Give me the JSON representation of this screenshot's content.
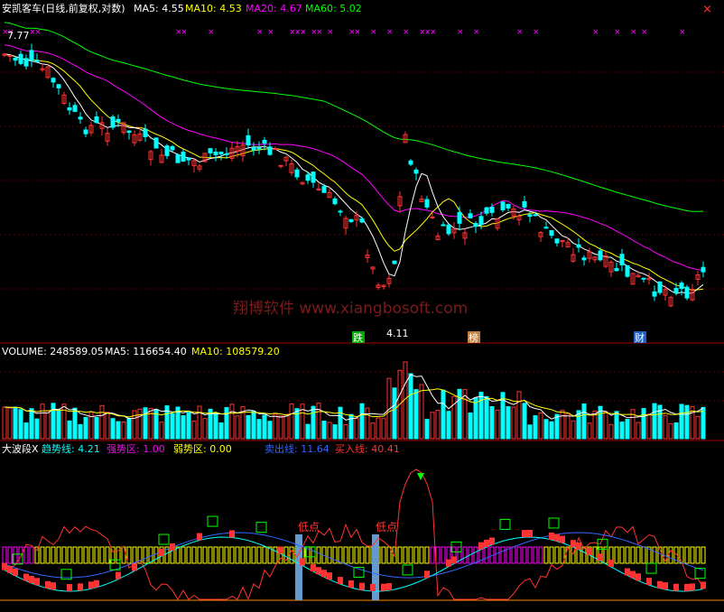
{
  "main_panel": {
    "title": "安凯客车(日线,前复权,对数)",
    "ma_labels": [
      {
        "name": "MA5",
        "value": "4.55",
        "color": "#ffffff"
      },
      {
        "name": "MA10",
        "value": "4.53",
        "color": "#ffff00"
      },
      {
        "name": "MA20",
        "value": "4.67",
        "color": "#ff00ff"
      },
      {
        "name": "MA60",
        "value": "5.02",
        "color": "#00ff00"
      }
    ],
    "high_label": "7.77",
    "low_label": "4.11",
    "markers": [
      "跌",
      "榜",
      "财"
    ],
    "watermark": "翔博软件 www.xiangbosoft.com"
  },
  "volume_panel": {
    "title": "VOLUME:",
    "volume": "248589.05",
    "ma5_label": "MA5:",
    "ma5": "116654.40",
    "ma10_label": "MA10:",
    "ma10": "108579.20"
  },
  "indicator_panel": {
    "name": "大波段X",
    "fields": [
      {
        "label": "趋势线:",
        "value": "4.21",
        "color": "#00ffff"
      },
      {
        "label": "强势区:",
        "value": "1.00",
        "color": "#ff00ff"
      },
      {
        "label": "弱势区:",
        "value": "0.00",
        "color": "#ffff00"
      },
      {
        "label": "卖出线:",
        "value": "11.64",
        "color": "#3366ff"
      },
      {
        "label": "买入线:",
        "value": "40.41",
        "color": "#ff3333"
      }
    ],
    "low_point_label": "低点",
    "low_point_label_2": "低点"
  },
  "colors": {
    "up": "#ff3333",
    "down": "#00ffff",
    "ma5": "#ffffff",
    "ma10": "#ffff00",
    "ma20": "#ff00ff",
    "ma60": "#00ff00",
    "panel_divider": "#aa0000"
  },
  "chart_data": {
    "type": "candlestick",
    "series_count": 130,
    "price_range_shown": [
      4.11,
      7.77
    ],
    "panels": [
      "price",
      "volume",
      "indicator"
    ]
  }
}
